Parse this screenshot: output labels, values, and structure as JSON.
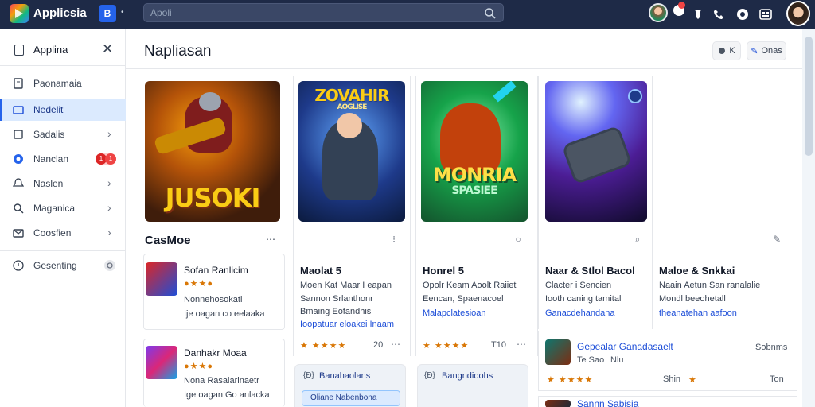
{
  "topbar": {
    "app_title": "Applicsia",
    "workspace_badge": "B",
    "search_placeholder": "Apoli"
  },
  "sidebar": {
    "header_label": "Applina",
    "items": [
      {
        "label": "Paonamaia"
      },
      {
        "label": "Nedelit"
      },
      {
        "label": "Sadalis"
      },
      {
        "label": "Nanclan"
      },
      {
        "label": "Naslen"
      },
      {
        "label": "Maganica"
      },
      {
        "label": "Coosfien"
      },
      {
        "label": "Gesenting"
      }
    ],
    "badge_values": [
      "1",
      "1"
    ]
  },
  "main": {
    "title": "Napliasan",
    "header_buttons": [
      {
        "label": "K"
      },
      {
        "label": "Onas"
      }
    ],
    "cards": [
      {
        "art_text": "JUSOKI",
        "title": "CasMoe"
      },
      {
        "art_text_top": "ZOVAHIR",
        "art_text_sub": "AOGLISE",
        "title": "Maolat 5",
        "lines": [
          "Moen Kat Maar I eapan",
          "Sannon Srlanthonr",
          "Bmaing Eofandhis"
        ],
        "link": "Ioopatuar eloakei Inaam",
        "rating_value": "20"
      },
      {
        "art_text": "MONRIA",
        "art_text_sub": "SPASIEE",
        "title": "Honrel 5",
        "lines": [
          "Opolr Keam Aoolt Raiiet",
          "Eencan, Spaenacoel"
        ],
        "link": "Malapclatesioan",
        "rating_value": "T10"
      },
      {
        "title": "Naar & Stlol Bacol",
        "lines": [
          "Clacter i Sencien",
          "Iooth caning tamital"
        ],
        "link": "Ganacdehandana"
      },
      {
        "title": "Maloe & Snkkai",
        "lines": [
          "Naain Aetun San ranalalie",
          "Mondl beeohetall"
        ],
        "link": "theanatehan aafoon"
      }
    ],
    "list_items": [
      {
        "title": "Sofan Ranlicim",
        "lines": [
          "Nonnehosokatl",
          "Ije oagan co eelaaka"
        ]
      },
      {
        "title": "Danhakr Moaa",
        "lines": [
          "Nona Rasalarinaetr",
          "Ige oagan Go anlacka"
        ]
      }
    ],
    "panels": [
      {
        "label": "Banahaolans",
        "pill": "Oliane Nabenbona"
      },
      {
        "label": "Bangndioohs"
      }
    ],
    "right_list": [
      {
        "title": "Gepealar Ganadasaelt",
        "meta": "Sobnms",
        "sub": "Te Sao",
        "sub2": "Nlu",
        "rating_meta": "Shin",
        "right_meta": "Ton"
      },
      {
        "title": "Sannn Sabisia"
      }
    ]
  }
}
